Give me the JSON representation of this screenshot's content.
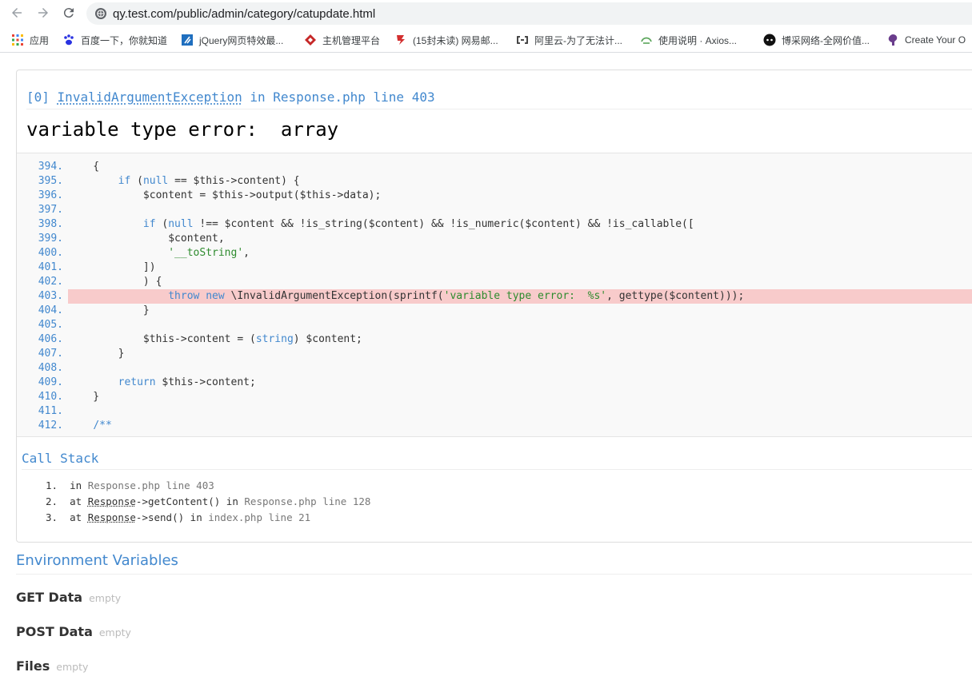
{
  "browser": {
    "url": "qy.test.com/public/admin/category/catupdate.html",
    "bookmarks": [
      {
        "label": "应用",
        "icon": "apps-grid-icon"
      },
      {
        "label": "百度一下，你就知道",
        "icon": "baidu-paw-icon"
      },
      {
        "label": "jQuery网页特效最...",
        "icon": "jquery-icon"
      },
      {
        "label": "主机管理平台",
        "icon": "host-panel-icon"
      },
      {
        "label": "(15封未读) 网易邮...",
        "icon": "netease-mail-icon"
      },
      {
        "label": "阿里云-为了无法计...",
        "icon": "aliyun-icon"
      },
      {
        "label": "使用说明 · Axios...",
        "icon": "axios-icon"
      },
      {
        "label": "博采网络-全网价值...",
        "icon": "bocai-icon"
      },
      {
        "label": "Create Your O",
        "icon": "create-icon"
      }
    ]
  },
  "exception": {
    "index": "[0]",
    "class": "InvalidArgumentException",
    "in_word": "in",
    "file": "Response.php",
    "line_word": "line",
    "line": "403",
    "message": "variable type error:  array"
  },
  "source": {
    "lines": [
      {
        "n": "394.",
        "code": "    {"
      },
      {
        "n": "395.",
        "code": "        if (null == $this->content) {"
      },
      {
        "n": "396.",
        "code": "            $content = $this->output($this->data);"
      },
      {
        "n": "397.",
        "code": ""
      },
      {
        "n": "398.",
        "code": "            if (null !== $content && !is_string($content) && !is_numeric($content) && !is_callable(["
      },
      {
        "n": "399.",
        "code": "                $content,"
      },
      {
        "n": "400.",
        "code": "                '__toString',"
      },
      {
        "n": "401.",
        "code": "            ])"
      },
      {
        "n": "402.",
        "code": "            ) {"
      },
      {
        "n": "403.",
        "code": "                throw new \\InvalidArgumentException(sprintf('variable type error:  %s', gettype($content)));"
      },
      {
        "n": "404.",
        "code": "            }"
      },
      {
        "n": "405.",
        "code": ""
      },
      {
        "n": "406.",
        "code": "            $this->content = (string) $content;"
      },
      {
        "n": "407.",
        "code": "        }"
      },
      {
        "n": "408.",
        "code": ""
      },
      {
        "n": "409.",
        "code": "        return $this->content;"
      },
      {
        "n": "410.",
        "code": "    }"
      },
      {
        "n": "411.",
        "code": ""
      },
      {
        "n": "412.",
        "code": "    /**"
      }
    ],
    "highlight": "403."
  },
  "call_stack": {
    "title": "Call Stack",
    "items": [
      {
        "num": "1.",
        "prefix": "in ",
        "cls": "",
        "method": "",
        "mid": "",
        "path": "Response.php line 403"
      },
      {
        "num": "2.",
        "prefix": "at ",
        "cls": "Response",
        "method": "->getContent()",
        "mid": " in ",
        "path": "Response.php line 128"
      },
      {
        "num": "3.",
        "prefix": "at ",
        "cls": "Response",
        "method": "->send()",
        "mid": " in ",
        "path": "index.php line 21"
      }
    ]
  },
  "environment": {
    "title": "Environment Variables",
    "rows": [
      {
        "label": "GET Data",
        "value": "empty"
      },
      {
        "label": "POST Data",
        "value": "empty"
      },
      {
        "label": "Files",
        "value": "empty"
      }
    ]
  }
}
